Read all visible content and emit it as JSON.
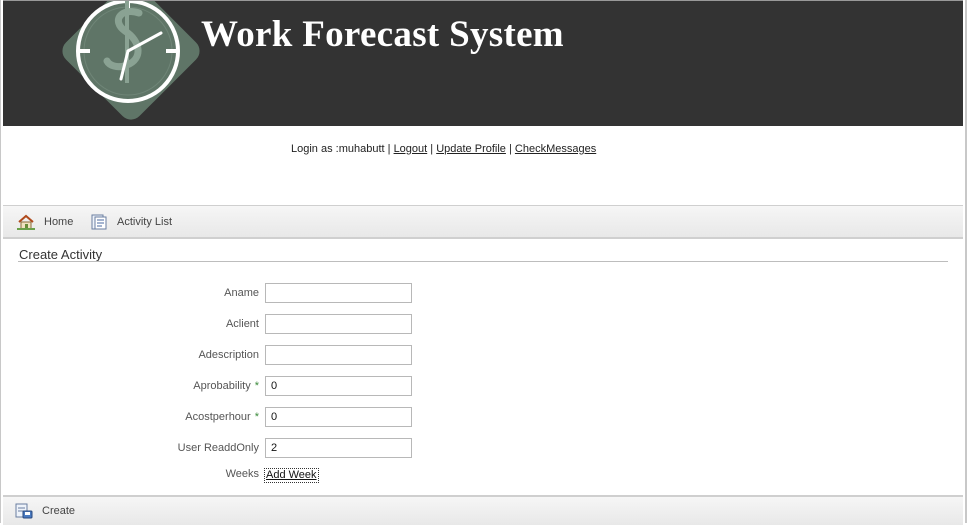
{
  "header": {
    "title": "Work Forecast System",
    "logo_icon": "dollar-clock-logo-icon"
  },
  "userbar": {
    "prefix": "Login as :muhabutt",
    "sep": " | ",
    "logout": "Logout",
    "update_profile": "Update Profile",
    "check_messages": "CheckMessages"
  },
  "nav": {
    "items": [
      {
        "label": "Home",
        "icon": "home-icon"
      },
      {
        "label": "Activity List",
        "icon": "list-icon"
      }
    ]
  },
  "section": {
    "title": "Create Activity"
  },
  "form": {
    "fields": [
      {
        "label": "Aname",
        "value": "",
        "required": false
      },
      {
        "label": "Aclient",
        "value": "",
        "required": false
      },
      {
        "label": "Adescription",
        "value": "",
        "required": false
      },
      {
        "label": "Aprobability",
        "value": "0",
        "required": true
      },
      {
        "label": "Acostperhour",
        "value": "0",
        "required": true
      },
      {
        "label": "User ReaddOnly",
        "value": "2",
        "required": false
      }
    ],
    "required_marker": "*",
    "weeks_label": "Weeks",
    "add_week": "Add Week"
  },
  "footer": {
    "create_label": "Create",
    "icon": "create-icon"
  },
  "colors": {
    "header_bg": "#333333",
    "logo_green": "#5f7567"
  }
}
